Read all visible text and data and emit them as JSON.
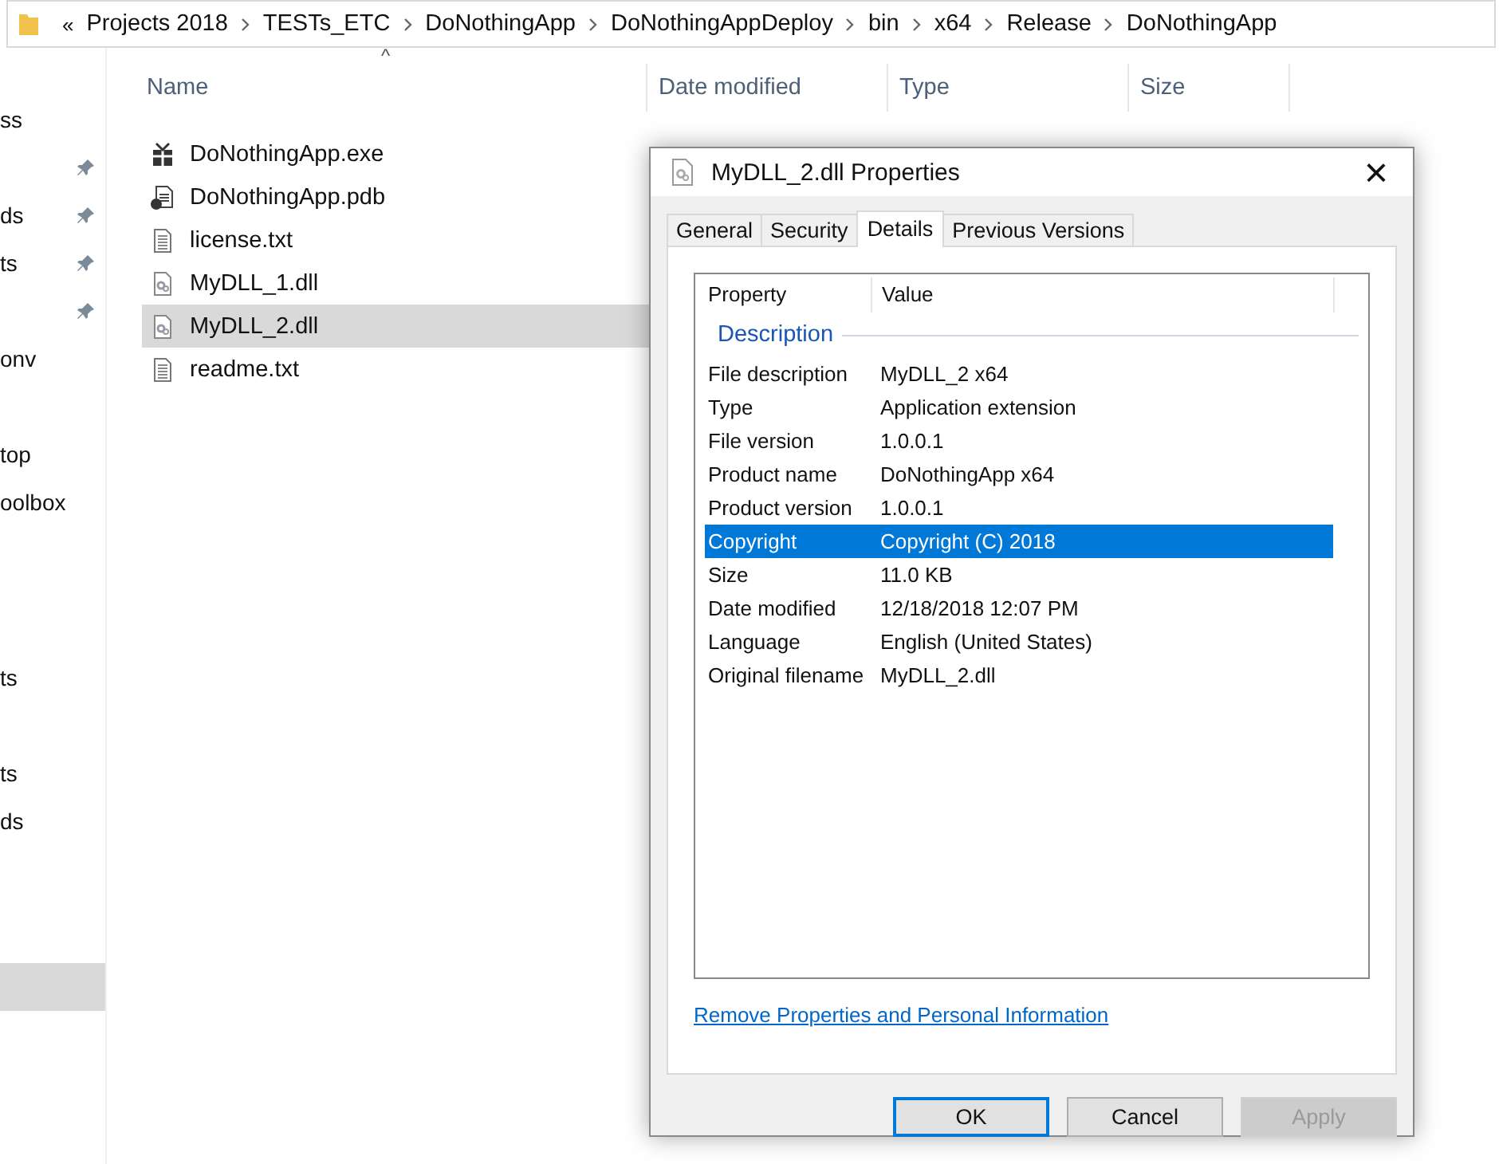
{
  "breadcrumb": {
    "overflow": "«",
    "segments": [
      "Projects 2018",
      "TESTs_ETC",
      "DoNothingApp",
      "DoNothingAppDeploy",
      "bin",
      "x64",
      "Release",
      "DoNothingApp"
    ]
  },
  "sidebar": {
    "groups": [
      [
        {
          "label": "ss",
          "pinned": false,
          "selected": false
        },
        {
          "pinned": true,
          "selected": false
        },
        {
          "label": "ds",
          "pinned": true,
          "selected": false
        },
        {
          "label": "ts",
          "pinned": true,
          "selected": false
        },
        {
          "pinned": true,
          "selected": false
        },
        {
          "label": "onv",
          "pinned": false,
          "selected": false
        }
      ],
      [
        {
          "label": "top",
          "pinned": false,
          "selected": false
        },
        {
          "label": "oolbox",
          "pinned": false,
          "selected": false
        }
      ],
      [
        {
          "label": "ts",
          "pinned": false,
          "selected": false
        }
      ],
      [
        {
          "label": "ts",
          "pinned": false,
          "selected": false
        },
        {
          "label": "ds",
          "pinned": false,
          "selected": false
        }
      ],
      [
        {
          "pinned": false,
          "selected": true
        }
      ]
    ]
  },
  "file_list": {
    "columns": [
      "Name",
      "Date modified",
      "Type",
      "Size"
    ],
    "sort_indicator": "^",
    "files": [
      {
        "name": "DoNothingApp.exe",
        "kind": "exe",
        "selected": false
      },
      {
        "name": "DoNothingApp.pdb",
        "kind": "pdb",
        "selected": false
      },
      {
        "name": "license.txt",
        "kind": "txt",
        "selected": false
      },
      {
        "name": "MyDLL_1.dll",
        "kind": "dll",
        "selected": false
      },
      {
        "name": "MyDLL_2.dll",
        "kind": "dll",
        "selected": true
      },
      {
        "name": "readme.txt",
        "kind": "txt",
        "selected": false
      }
    ]
  },
  "dialog": {
    "title": "MyDLL_2.dll Properties",
    "close": "×",
    "tabs": [
      {
        "label": "General",
        "selected": false
      },
      {
        "label": "Security",
        "selected": false
      },
      {
        "label": "Details",
        "selected": true
      },
      {
        "label": "Previous Versions",
        "selected": false
      }
    ],
    "columns": [
      "Property",
      "Value"
    ],
    "section": "Description",
    "rows": [
      {
        "property": "File description",
        "value": "MyDLL_2 x64",
        "selected": false
      },
      {
        "property": "Type",
        "value": "Application extension",
        "selected": false
      },
      {
        "property": "File version",
        "value": "1.0.0.1",
        "selected": false
      },
      {
        "property": "Product name",
        "value": "DoNothingApp x64",
        "selected": false
      },
      {
        "property": "Product version",
        "value": "1.0.0.1",
        "selected": false
      },
      {
        "property": "Copyright",
        "value": "Copyright (C) 2018",
        "selected": true
      },
      {
        "property": "Size",
        "value": "11.0 KB",
        "selected": false
      },
      {
        "property": "Date modified",
        "value": "12/18/2018 12:07 PM",
        "selected": false
      },
      {
        "property": "Language",
        "value": "English (United States)",
        "selected": false
      },
      {
        "property": "Original filename",
        "value": "MyDLL_2.dll",
        "selected": false
      }
    ],
    "link": "Remove Properties and Personal Information",
    "buttons": [
      {
        "label": "OK",
        "default": true,
        "disabled": false
      },
      {
        "label": "Cancel",
        "default": false,
        "disabled": false
      },
      {
        "label": "Apply",
        "default": false,
        "disabled": true
      }
    ]
  }
}
